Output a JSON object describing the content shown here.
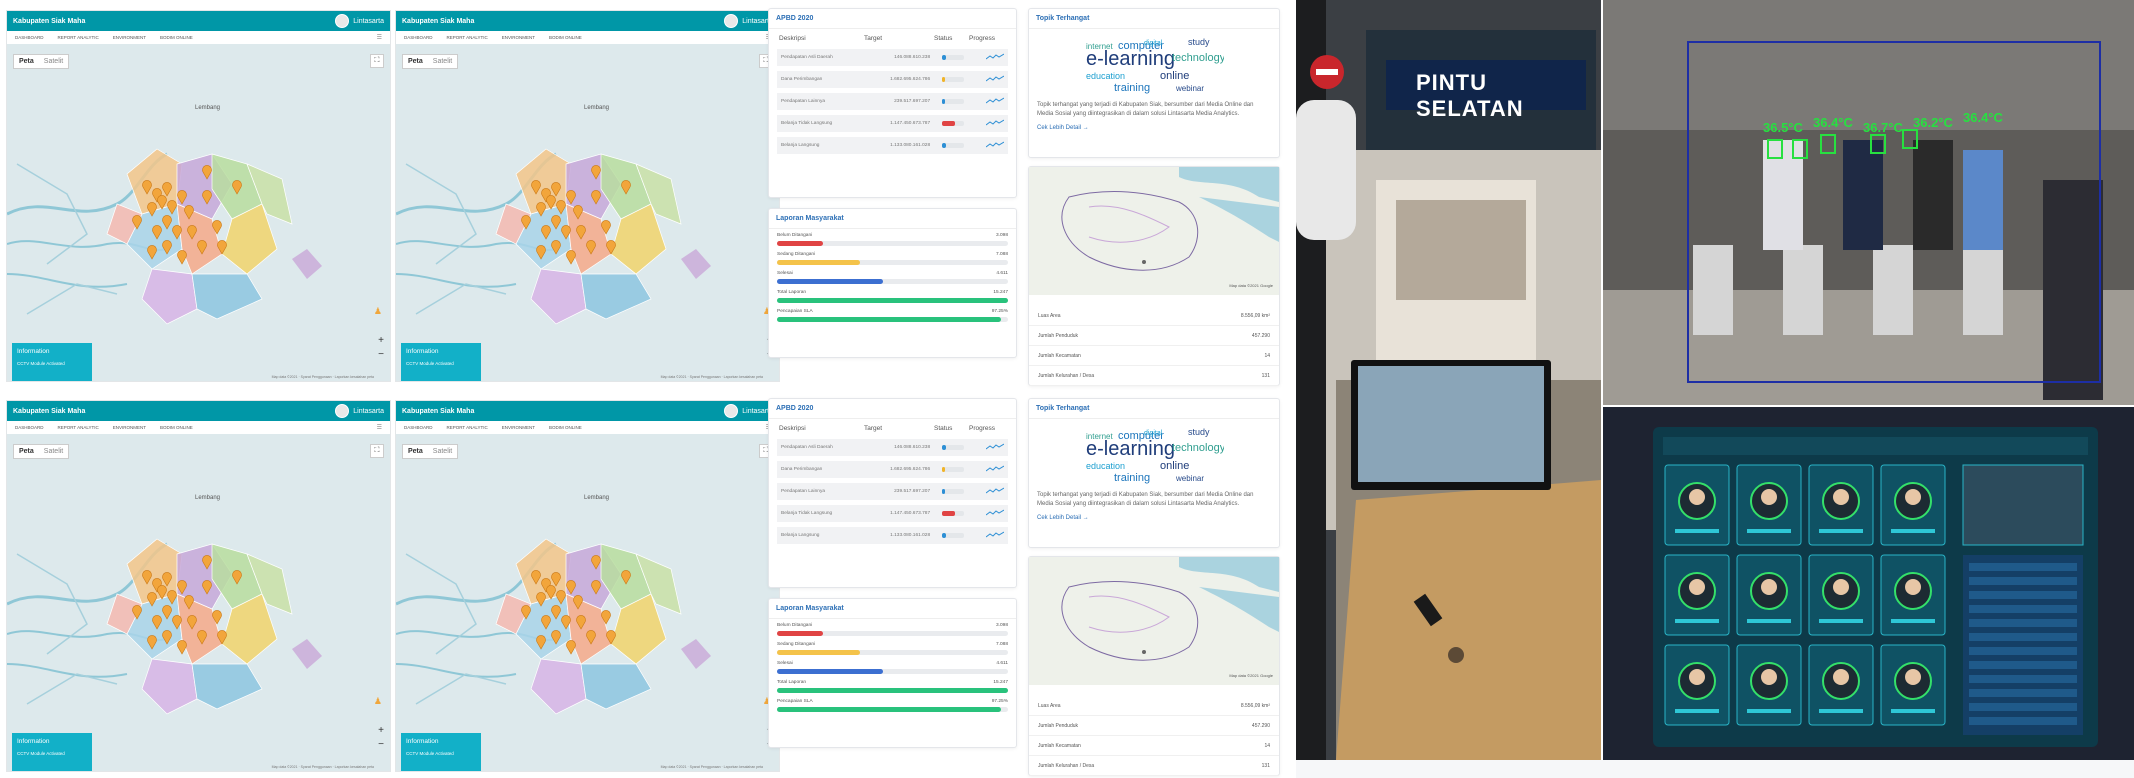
{
  "map_dashboard": {
    "brand": "Kabupaten Siak Maha",
    "user": "Lintasarta",
    "nav": [
      "DASHBOARD",
      "REPORT ANALYTIC",
      "ENVIRONMENT",
      "BODIM ONLINE"
    ],
    "nav_alt": [
      "DASHBOARD",
      "REPORT ANALYTIC",
      "ENVIRONMENT",
      "BODIM ONLINE"
    ],
    "toggle_map": "Peta",
    "toggle_sat": "Satelit",
    "place_lembang": "Lembang",
    "info_title": "Information",
    "info_sub": "CCTV Module Activated",
    "attribution": "Map data ©2021 · Syarat Penggunaan · Laporkan kesalahan peta",
    "fullscreen_glyph": "⛶",
    "pegman_glyph": "♟",
    "zoom_in": "+",
    "zoom_out": "−"
  },
  "apbd": {
    "title": "APBD 2020",
    "head": [
      "Deskripsi",
      "Target",
      "Status",
      "Progress"
    ],
    "rows": [
      {
        "desc": "Pendapatan Asli Daerah",
        "target": "146.088.610.238",
        "status": 0.18,
        "color": "#2d8fd5"
      },
      {
        "desc": "Dana Perimbangan",
        "target": "1.682.695.624.786",
        "status": 0.12,
        "color": "#f0b429"
      },
      {
        "desc": "Pendapatan Lainnya",
        "target": "239.517.697.207",
        "status": 0.15,
        "color": "#2d8fd5"
      },
      {
        "desc": "Belanja Tidak Langsung",
        "target": "1.147.450.673.787",
        "status": 0.6,
        "color": "#e04444"
      },
      {
        "desc": "Belanja Langsung",
        "target": "1.133.080.161.028",
        "status": 0.18,
        "color": "#2d8fd5"
      }
    ]
  },
  "laporan": {
    "title": "Laporan Masyarakat",
    "rows": [
      {
        "label": "Belum Ditangani",
        "value": "3.098",
        "pct": 0.2,
        "color": "#e04444"
      },
      {
        "label": "Sedang Ditangani",
        "value": "7.088",
        "pct": 0.36,
        "color": "#f4c34a"
      },
      {
        "label": "Selesai",
        "value": "4.611",
        "pct": 0.46,
        "color": "#3c6fd1"
      },
      {
        "label": "Total Laporan",
        "value": "15.247",
        "pct": 1.0,
        "color": "#29c27c"
      },
      {
        "label": "Pencapaian SLA",
        "value": "97.25%",
        "pct": 0.97,
        "color": "#29c27c"
      }
    ]
  },
  "topik": {
    "title": "Topik Terhangat",
    "desc": "Topik terhangat yang terjadi di Kabupaten Siak, bersumber dari Media Online dan Media Sosial yang diintegrasikan di dalam solusi Lintasarta Media Analytics.",
    "link": "Cek Lebih Detail →",
    "words": [
      "e-learning",
      "computer",
      "technology",
      "study",
      "education",
      "online",
      "training",
      "internet",
      "webinar",
      "digital"
    ],
    "map_caption": "Map data ©2021 Google",
    "stats": [
      {
        "label": "Luas Area",
        "value": "8.556,09 km²"
      },
      {
        "label": "Jumlah Penduduk",
        "value": "457.290"
      },
      {
        "label": "Jumlah Kecamatan",
        "value": "14"
      },
      {
        "label": "Jumlah Kelurahan / Desa",
        "value": "131"
      }
    ]
  },
  "photos": {
    "station_sign": "PINTU SELATAN",
    "temps": [
      "36.5°C",
      "36.4°C",
      "36.7°C",
      "36.2°C",
      "36.4°C"
    ]
  }
}
